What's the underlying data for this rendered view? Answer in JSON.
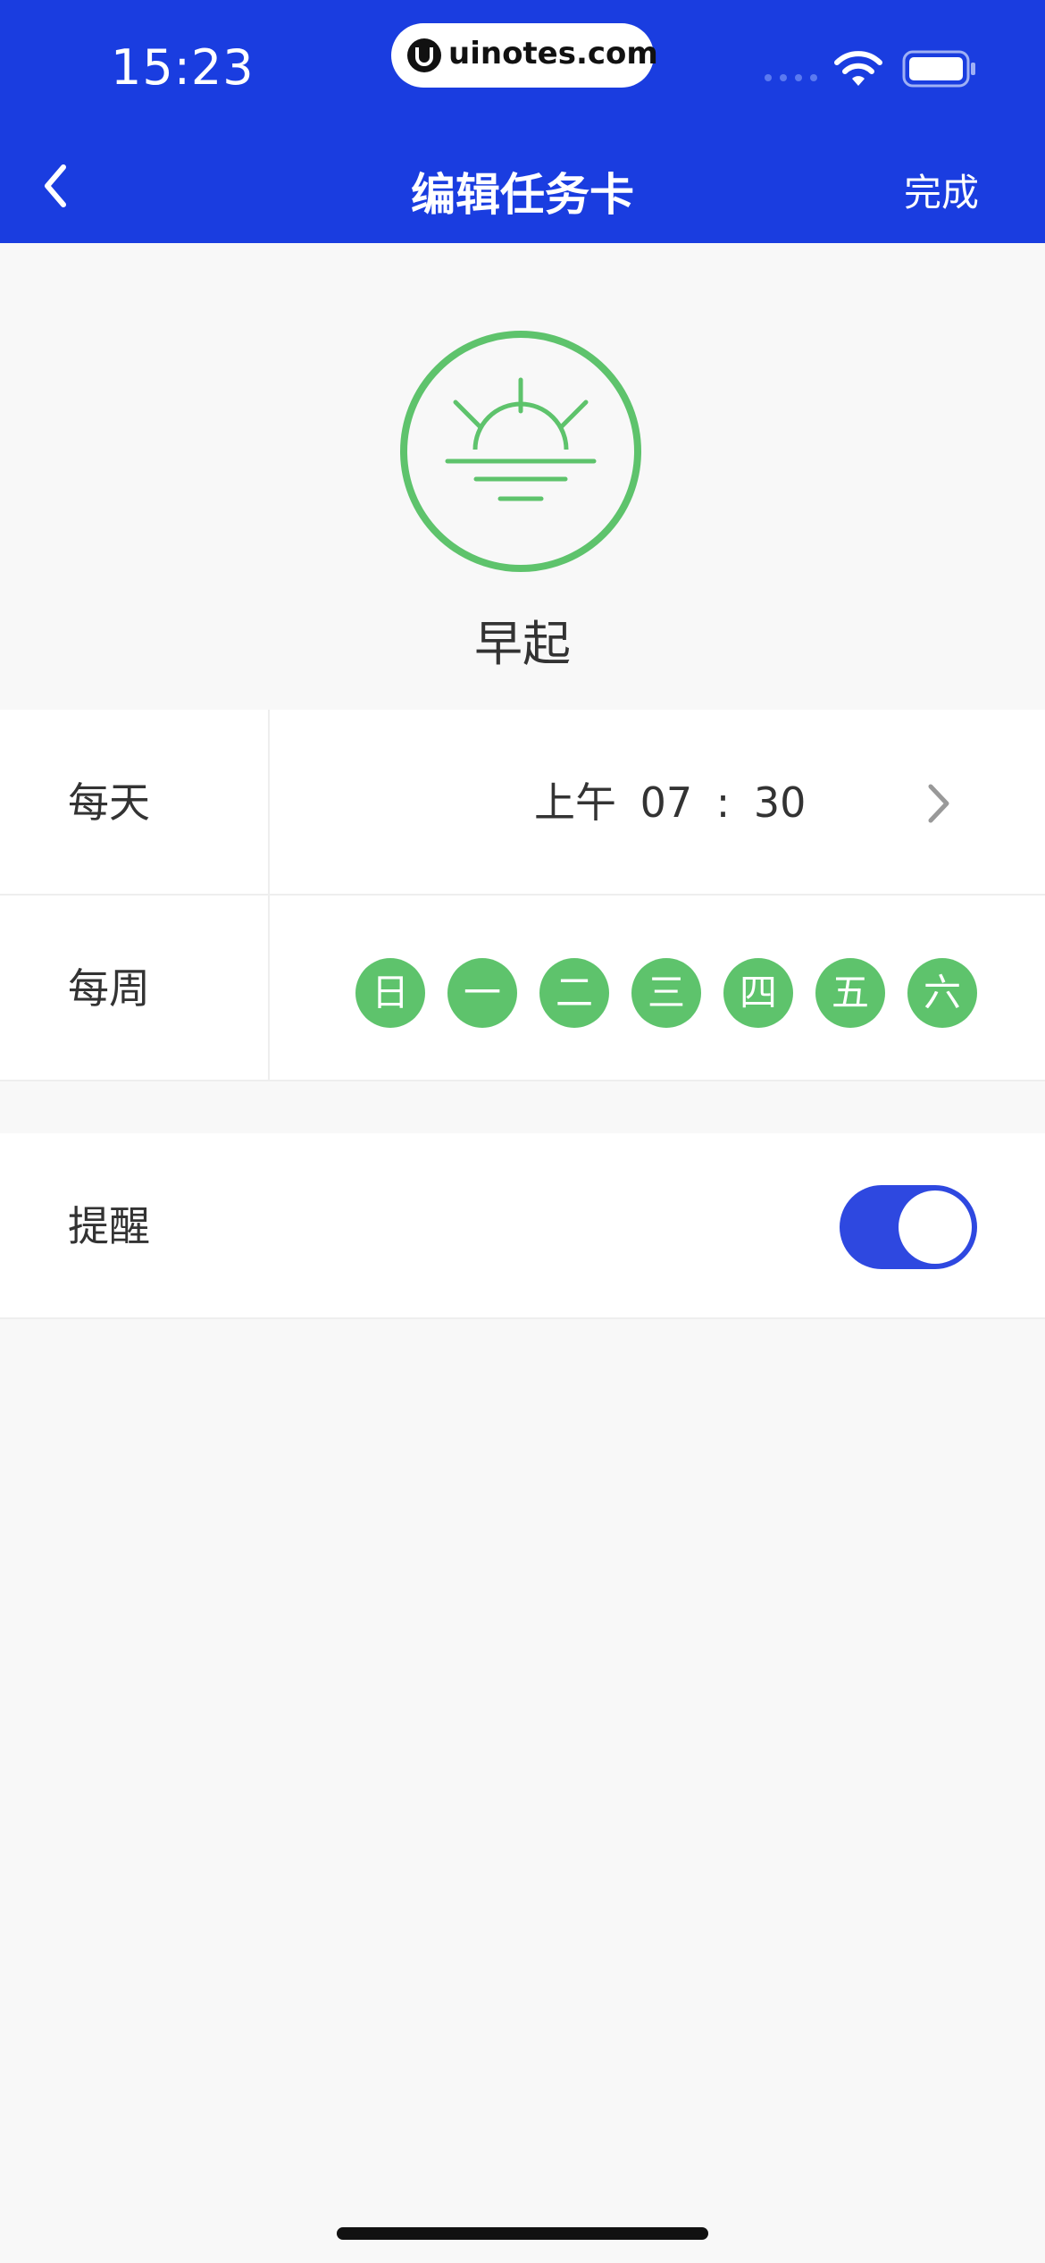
{
  "status_bar": {
    "time": "15:23",
    "watermark": "uinotes.com"
  },
  "nav": {
    "back_icon": "chevron-left-icon",
    "title": "编辑任务卡",
    "done_label": "完成"
  },
  "task": {
    "icon": "sunrise-icon",
    "name": "早起"
  },
  "daily_row": {
    "label": "每天",
    "time": "上午  07 : 30"
  },
  "weekly_row": {
    "label": "每周",
    "days": [
      "日",
      "一",
      "二",
      "三",
      "四",
      "五",
      "六"
    ]
  },
  "reminder_row": {
    "label": "提醒",
    "enabled": true
  },
  "colors": {
    "header_blue": "#1a3de0",
    "accent_green": "#5ec36c",
    "toggle_blue": "#2e48e0",
    "background": "#f8f8f8"
  }
}
